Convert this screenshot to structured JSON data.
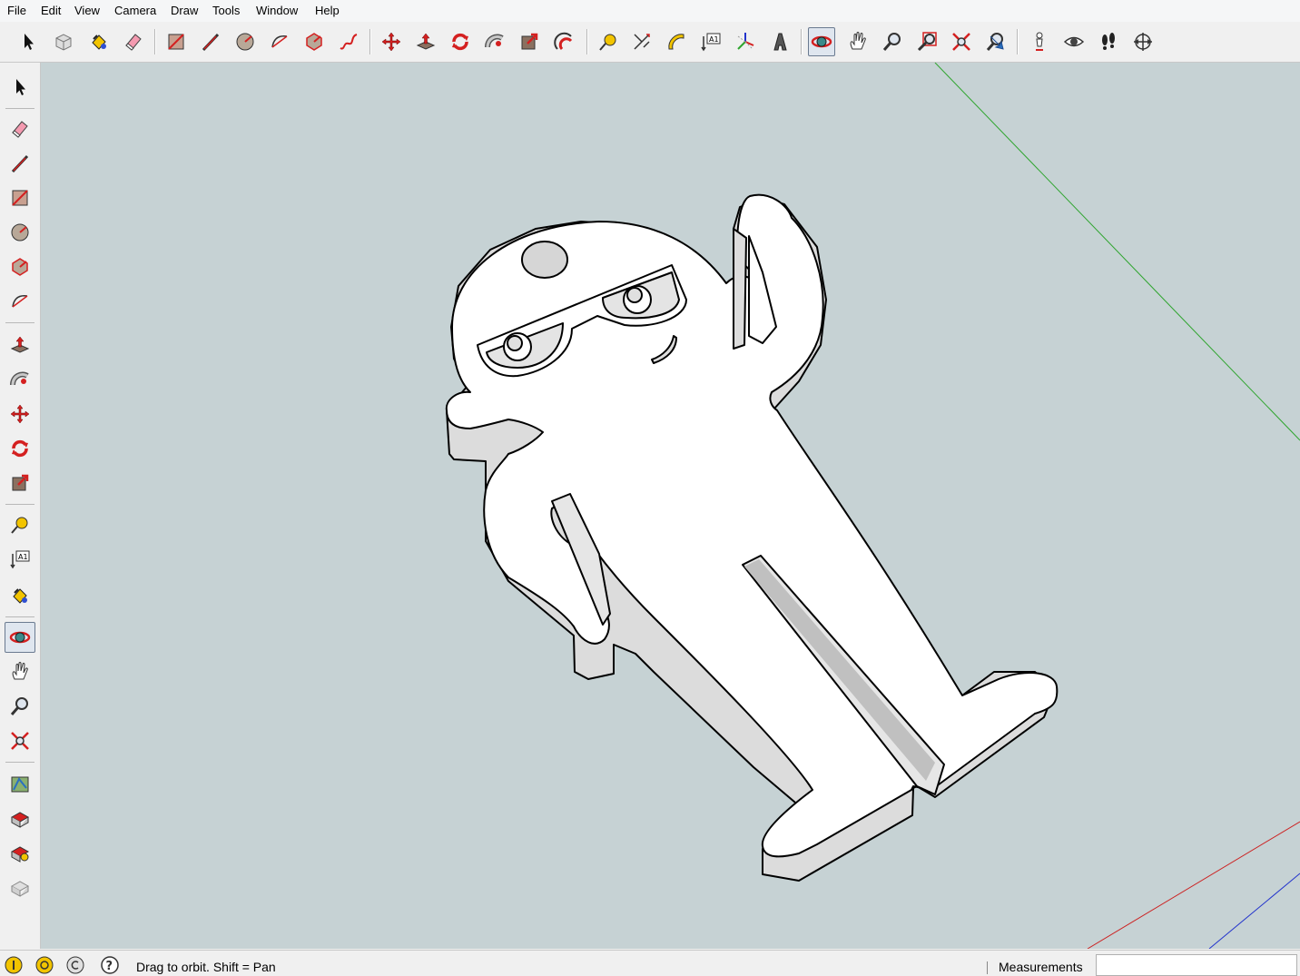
{
  "menu": [
    "File",
    "Edit",
    "View",
    "Camera",
    "Draw",
    "Tools",
    "Window",
    "Help"
  ],
  "status": {
    "hint": "Drag to orbit.  Shift = Pan",
    "measurements_label": "Measurements",
    "measurements_value": ""
  },
  "colors": {
    "viewport": "#c6d2d4",
    "axis_green": "#2fa52f",
    "axis_red": "#cc2222",
    "axis_blue": "#2233cc",
    "model_face": "#ffffff",
    "model_side": "#dcdcdc",
    "icon_red": "#d42020"
  },
  "top_toolbar": [
    "select-icon",
    "make-component-icon",
    "paint-bucket-icon",
    "eraser-icon",
    "rectangle-icon",
    "line-icon",
    "circle-icon",
    "arc-icon",
    "polygon-icon",
    "freehand-icon",
    "move-icon",
    "push-pull-icon",
    "rotate-icon",
    "follow-me-icon",
    "scale-icon",
    "offset-icon",
    "tape-measure-icon",
    "dimensions-icon",
    "protractor-icon",
    "text-icon",
    "axes-icon",
    "3d-text-icon",
    "orbit-icon",
    "pan-icon",
    "zoom-icon",
    "zoom-window-icon",
    "zoom-extents-icon",
    "previous-view-icon",
    "position-camera-icon",
    "look-around-icon",
    "walk-icon",
    "section-plane-icon"
  ],
  "left_toolbar": [
    "select-icon",
    "eraser-icon",
    "line-icon",
    "rectangle-icon",
    "circle-icon",
    "polygon-icon",
    "arc-icon",
    "push-pull-icon",
    "follow-me-icon",
    "move-icon",
    "rotate-icon",
    "scale-icon",
    "tape-measure-icon",
    "text-icon",
    "paint-bucket-icon",
    "orbit-icon",
    "pan-icon",
    "zoom-icon",
    "zoom-extents-icon",
    "get-models-icon",
    "share-model-icon",
    "get-photo-texture-icon",
    "preview-model-icon"
  ],
  "active_tool": "orbit-icon"
}
